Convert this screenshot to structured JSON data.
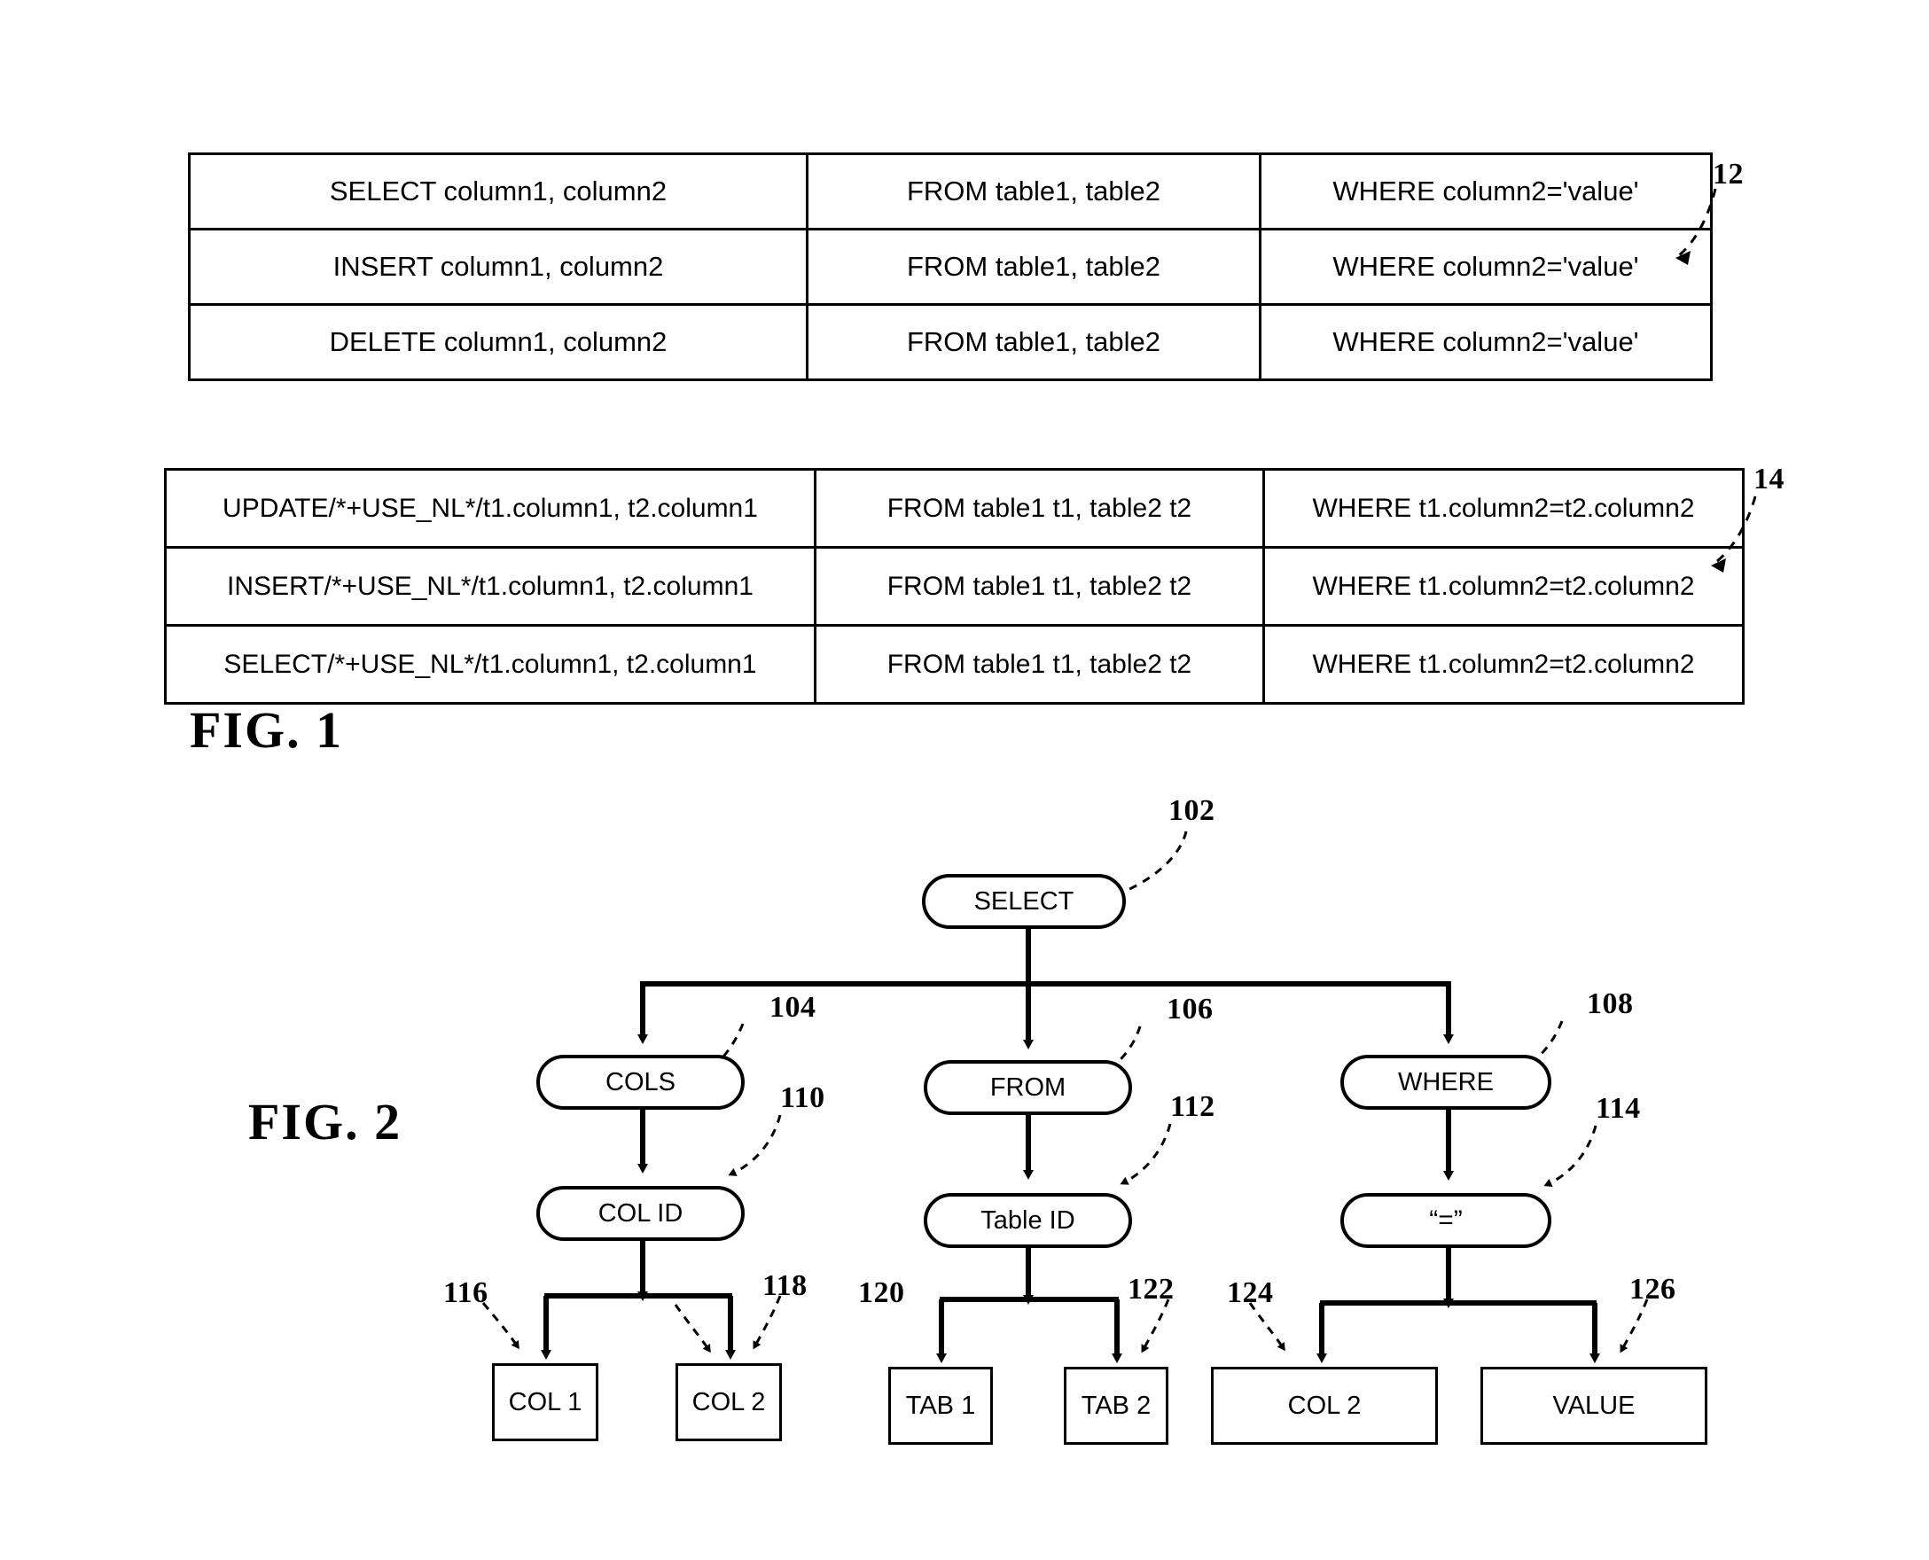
{
  "figures": [
    {
      "id": "fig1",
      "caption": "FIG. 1"
    },
    {
      "id": "fig2",
      "caption": "FIG. 2"
    }
  ],
  "fig1": {
    "caption": "FIG. 1",
    "table_12": {
      "ref": "12",
      "rows": [
        {
          "c1": "SELECT column1, column2",
          "c2": "FROM table1, table2",
          "c3": "WHERE column2='value'"
        },
        {
          "c1": "INSERT column1, column2",
          "c2": "FROM table1, table2",
          "c3": "WHERE column2='value'"
        },
        {
          "c1": "DELETE column1, column2",
          "c2": "FROM table1, table2",
          "c3": "WHERE column2='value'"
        }
      ]
    },
    "table_14": {
      "ref": "14",
      "rows": [
        {
          "c1": "UPDATE/*+USE_NL*/t1.column1, t2.column1",
          "c2": "FROM table1 t1, table2 t2",
          "c3": "WHERE t1.column2=t2.column2"
        },
        {
          "c1": "INSERT/*+USE_NL*/t1.column1, t2.column1",
          "c2": "FROM table1 t1, table2 t2",
          "c3": "WHERE t1.column2=t2.column2"
        },
        {
          "c1": "SELECT/*+USE_NL*/t1.column1, t2.column1",
          "c2": "FROM table1 t1, table2 t2",
          "c3": "WHERE t1.column2=t2.column2"
        }
      ]
    }
  },
  "fig2": {
    "caption": "FIG. 2",
    "nodes": {
      "root": {
        "label": "SELECT",
        "ref": "102"
      },
      "cols": {
        "label": "COLS",
        "ref": "104"
      },
      "from": {
        "label": "FROM",
        "ref": "106"
      },
      "where": {
        "label": "WHERE",
        "ref": "108"
      },
      "colid": {
        "label": "COL ID",
        "ref": "110"
      },
      "tableid": {
        "label": "Table ID",
        "ref": "112"
      },
      "equals": {
        "label": "“=”",
        "ref": "114"
      },
      "col1": {
        "label": "COL 1",
        "ref": "116"
      },
      "col2a": {
        "label": "COL 2",
        "ref": "118"
      },
      "tab1": {
        "label": "TAB 1",
        "ref": "120"
      },
      "tab2": {
        "label": "TAB 2",
        "ref": "122"
      },
      "col2b": {
        "label": "COL 2",
        "ref": "124"
      },
      "value": {
        "label": "VALUE",
        "ref": "126"
      }
    }
  },
  "colors": {
    "ink": "#000000",
    "page": "#ffffff"
  }
}
